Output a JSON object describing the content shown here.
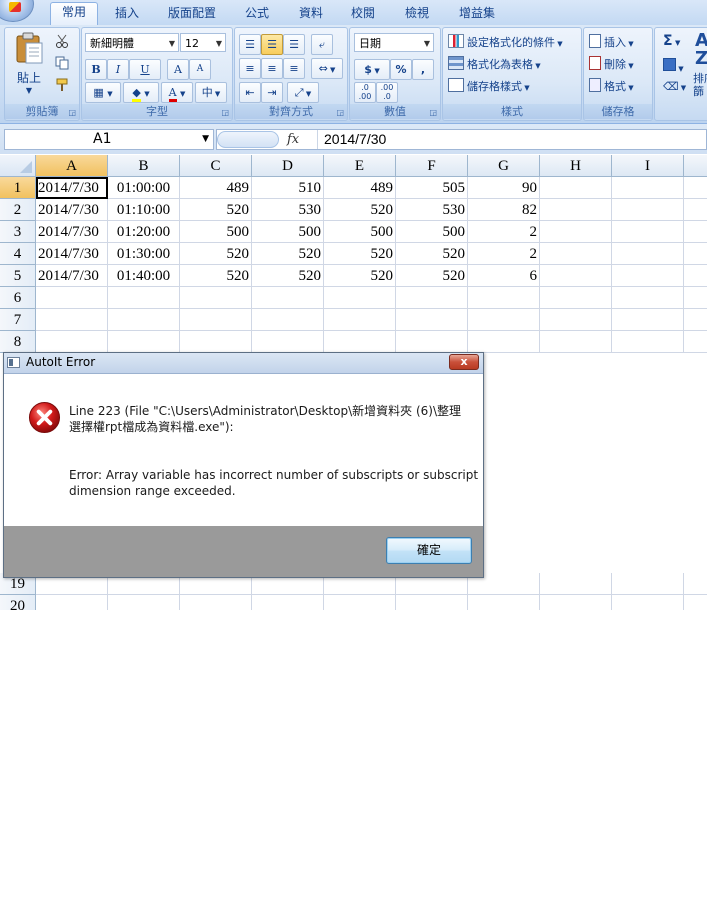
{
  "ribbon": {
    "tabs": [
      "常用",
      "插入",
      "版面配置",
      "公式",
      "資料",
      "校閱",
      "檢視",
      "增益集"
    ],
    "groups": {
      "clipboard": {
        "label": "剪貼簿",
        "paste": "貼上"
      },
      "font": {
        "label": "字型",
        "font_name": "新細明體",
        "font_size": "12",
        "bold": "B",
        "italic": "I",
        "underline": "U",
        "grow": "A",
        "shrink": "A",
        "font_color": "A",
        "phonetic": "中"
      },
      "alignment": {
        "label": "對齊方式"
      },
      "number": {
        "label": "數值",
        "format": "日期",
        "currency": "$",
        "percent": "%",
        "comma": ",",
        "inc_decimal": ".0 .00",
        "dec_decimal": ".00 .0"
      },
      "styles": {
        "label": "樣式",
        "conditional": "設定格式化的條件",
        "as_table": "格式化為表格",
        "cell_styles": "儲存格樣式"
      },
      "cells": {
        "label": "儲存格",
        "insert": "插入",
        "delete": "刪除",
        "format": "格式"
      },
      "editing": {
        "sum": "Σ",
        "sort": "排序",
        "filter": "篩"
      }
    }
  },
  "formula_bar": {
    "name_box": "A1",
    "fx": "fx",
    "value": "2014/7/30"
  },
  "grid": {
    "columns": [
      "A",
      "B",
      "C",
      "D",
      "E",
      "F",
      "G",
      "H",
      "I"
    ],
    "row_numbers": [
      "1",
      "2",
      "3",
      "4",
      "5",
      "6",
      "7",
      "8",
      "19",
      "20"
    ],
    "rows": [
      [
        "2014/7/30",
        "01:00:00",
        "489",
        "510",
        "489",
        "505",
        "90"
      ],
      [
        "2014/7/30",
        "01:10:00",
        "520",
        "530",
        "520",
        "530",
        "82"
      ],
      [
        "2014/7/30",
        "01:20:00",
        "500",
        "500",
        "500",
        "500",
        "2"
      ],
      [
        "2014/7/30",
        "01:30:00",
        "520",
        "520",
        "520",
        "520",
        "2"
      ],
      [
        "2014/7/30",
        "01:40:00",
        "520",
        "520",
        "520",
        "520",
        "6"
      ]
    ]
  },
  "dialog": {
    "title": "AutoIt Error",
    "close": "x",
    "line1": "Line 223  (File \"C:\\Users\\Administrator\\Desktop\\新增資料夾 (6)\\整理",
    "line2": "選擇權rpt檔成為資料檔.exe\"):",
    "error1": "Error: Array variable has incorrect number of subscripts or subscript",
    "error2": "dimension range exceeded.",
    "ok": "確定"
  },
  "colors": {
    "ribbon_bg": "#c9dcf3",
    "header_selected": "#f1c15f",
    "dialog_footer": "#9a9a9a",
    "error_red": "#c8102e"
  }
}
